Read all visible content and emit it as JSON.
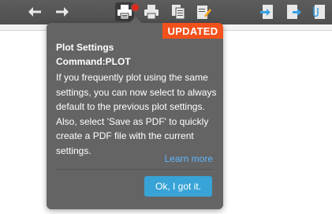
{
  "toolbar": {
    "icons": [
      "undo-icon",
      "redo-icon",
      "plot-icon",
      "print-icon",
      "copy-doc-icon",
      "edit-doc-icon",
      "export-icon",
      "import-icon",
      "attach-icon"
    ]
  },
  "popover": {
    "badge": "UPDATED",
    "title": "Plot Settings",
    "command": "Command:PLOT",
    "body": "If you frequently plot using the same settings, you can now select to always default to the previous plot settings. Also, select 'Save as PDF' to quickly create a PDF file with the current settings.",
    "learn_more": "Learn more",
    "ok_button": "Ok, I got it."
  },
  "colors": {
    "toolbar_bg": "#555555",
    "popover_bg": "#646464",
    "badge_bg": "#f2511b",
    "button_bg": "#38a3d6",
    "link": "#5fb6ff",
    "notification_dot": "#e02a1d"
  }
}
